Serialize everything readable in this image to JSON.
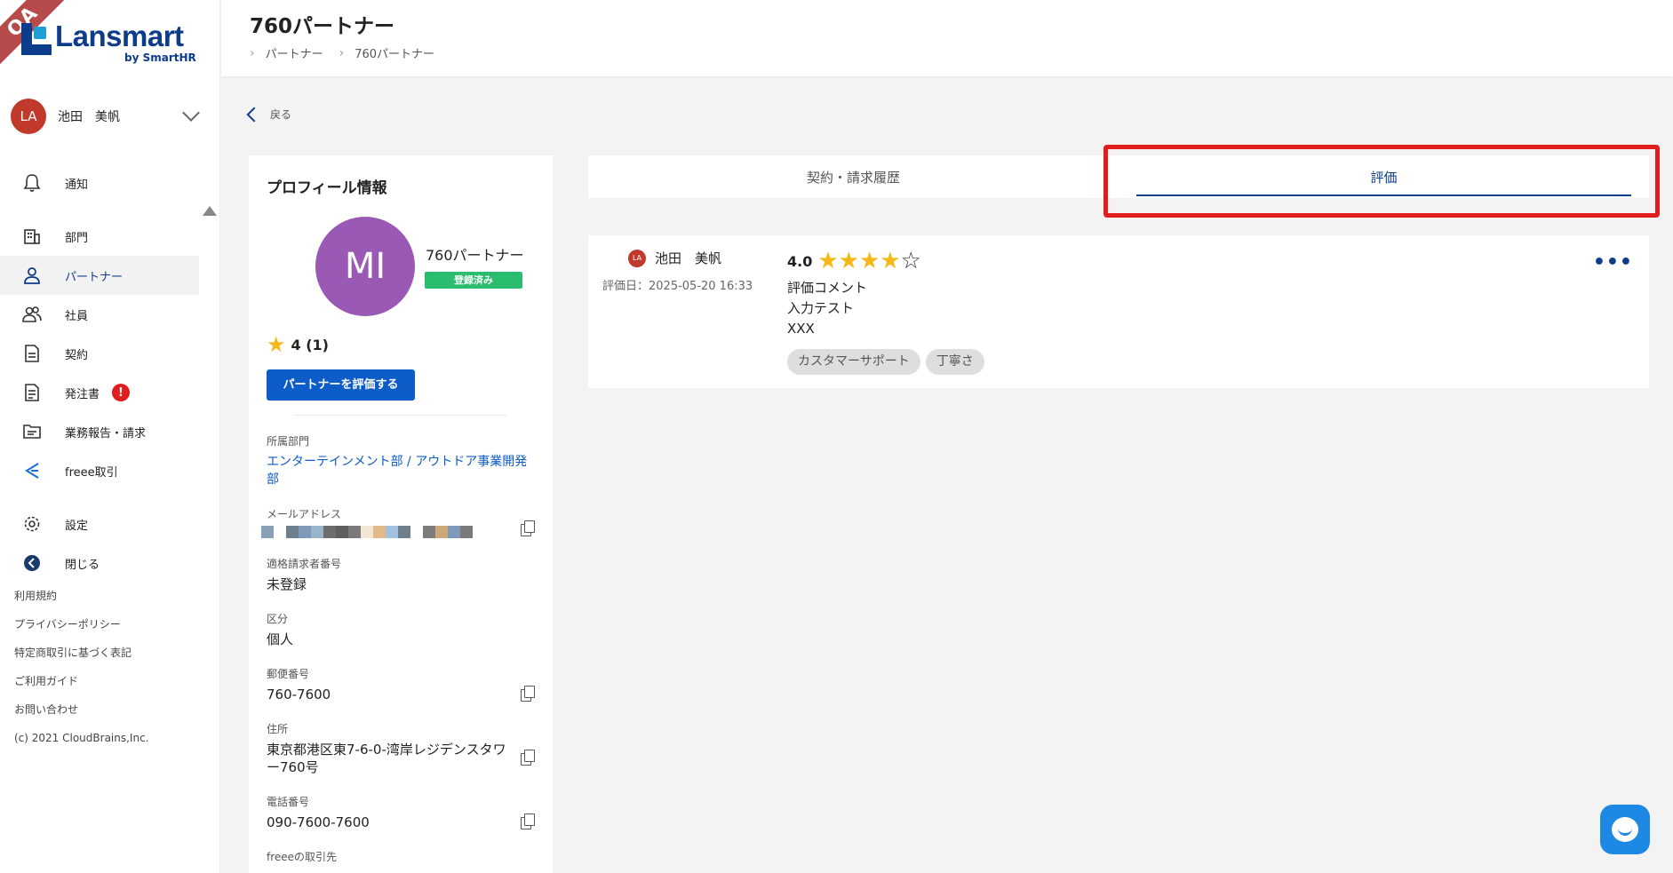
{
  "brand": {
    "ribbon": "QA",
    "name": "Lansmart",
    "sub": "by SmartHR"
  },
  "user": {
    "initials": "LA",
    "name": "池田　美帆"
  },
  "nav": {
    "notify": "通知",
    "department": "部門",
    "partner": "パートナー",
    "employee": "社員",
    "contract": "契約",
    "order": "発注書",
    "order_badge": "!",
    "report": "業務報告・請求",
    "freee": "freee取引",
    "settings": "設定",
    "close": "閉じる"
  },
  "footer": {
    "terms": "利用規約",
    "privacy": "プライバシーポリシー",
    "law": "特定商取引に基づく表記",
    "guide": "ご利用ガイド",
    "contact": "お問い合わせ",
    "copyright": "(c) 2021 CloudBrains,Inc."
  },
  "header": {
    "title": "760パートナー",
    "breadcrumb": [
      "パートナー",
      "760パートナー"
    ]
  },
  "back": "戻る",
  "profile": {
    "heading": "プロフィール情報",
    "initials": "MI",
    "name": "760パートナー",
    "status": "登録済み",
    "rating": "4 (1)",
    "eval_button": "パートナーを評価する",
    "dept_label": "所属部門",
    "dept_value": "エンターテインメント部 / アウトドア事業開発部",
    "email_label": "メールアドレス",
    "invoice_label": "適格請求者番号",
    "invoice_value": "未登録",
    "type_label": "区分",
    "type_value": "個人",
    "zip_label": "郵便番号",
    "zip_value": "760-7600",
    "address_label": "住所",
    "address_value": "東京都港区東7-6-0-湾岸レジデンスタワー760号",
    "phone_label": "電話番号",
    "phone_value": "090-7600-7600",
    "freee_label": "freeeの取引先"
  },
  "tabs": {
    "history": "契約・請求履歴",
    "review": "評価"
  },
  "review": {
    "initials": "LA",
    "reviewer": "池田　美帆",
    "date": "評価日：2025-05-20 16:33",
    "score": "4.0",
    "stars": 4,
    "comment": [
      "評価コメント",
      "入力テスト",
      "XXX"
    ],
    "tags": [
      "カスタマーサポート",
      "丁寧さ"
    ],
    "more": "•••"
  },
  "colors": {
    "brand": "#0d3c8a",
    "accent": "#0d5cc7",
    "star": "#f6b817",
    "highlight": "#e01e1e"
  }
}
